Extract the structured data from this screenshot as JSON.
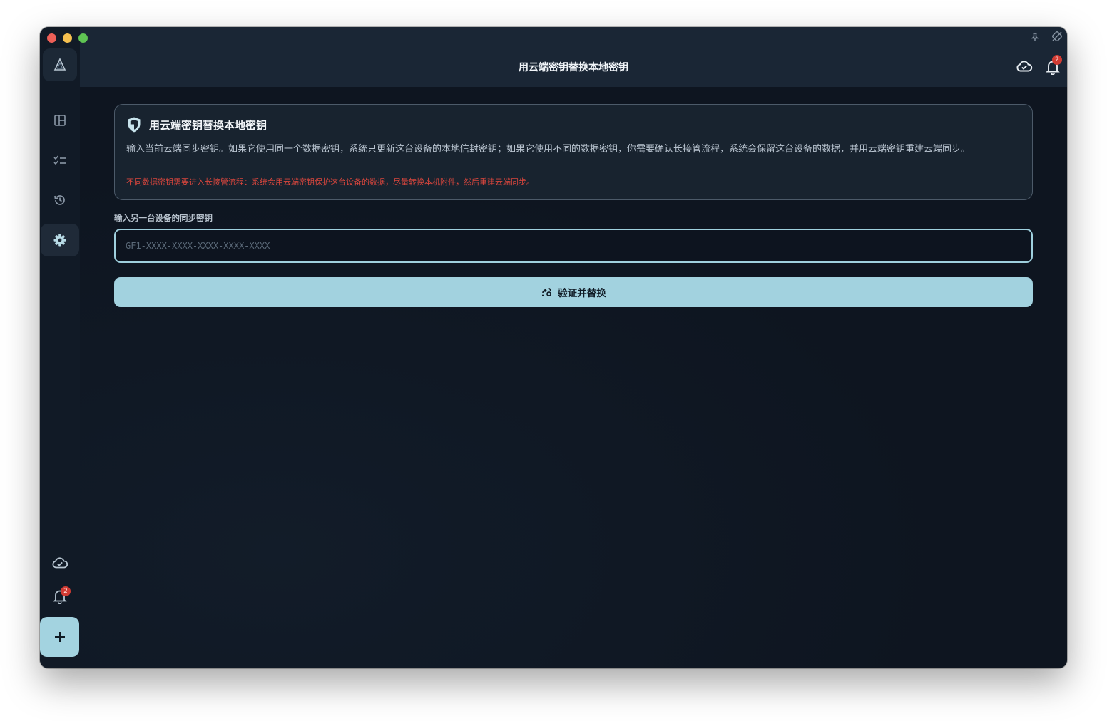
{
  "window": {
    "title": "用云端密钥替换本地密钥"
  },
  "sidebar": {
    "items": [
      {
        "name": "dashboard",
        "icon": "layout-icon"
      },
      {
        "name": "tasks",
        "icon": "checklist-icon"
      },
      {
        "name": "history",
        "icon": "history-icon"
      },
      {
        "name": "settings",
        "icon": "gear-icon",
        "active": true
      }
    ],
    "sync_icon": "cloud-check-icon",
    "notifications_badge": "2",
    "add_icon": "plus-icon"
  },
  "topbar": {
    "title": "用云端密钥替换本地密钥",
    "notifications_badge": "2"
  },
  "card": {
    "icon": "shield-icon",
    "title": "用云端密钥替换本地密钥",
    "description": "输入当前云端同步密钥。如果它使用同一个数据密钥，系统只更新这台设备的本地信封密钥；如果它使用不同的数据密钥，你需要确认长接管流程，系统会保留这台设备的数据，并用云端密钥重建云端同步。",
    "warning": "不同数据密钥需要进入长接管流程：系统会用云端密钥保护这台设备的数据，尽量转换本机附件，然后重建云端同步。"
  },
  "form": {
    "label": "输入另一台设备的同步密钥",
    "input_value": "",
    "input_placeholder": "GF1-XXXX-XXXX-XXXX-XXXX-XXXX",
    "submit_label": "验证并替换"
  },
  "colors": {
    "accent": "#a2d2df",
    "warning": "#d9463d",
    "badge": "#d13b33",
    "background": "#0e1520"
  }
}
